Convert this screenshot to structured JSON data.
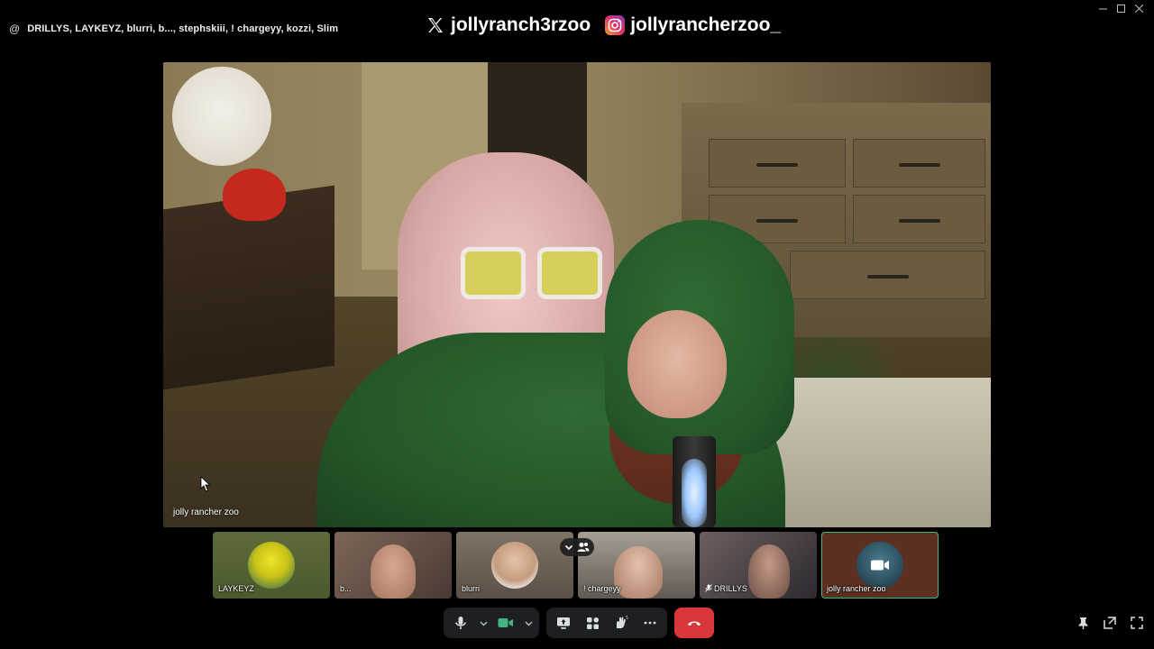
{
  "header": {
    "at_symbol": "@",
    "participants_summary": "DRILLYS, LAYKEYZ, blurri, b..., stephskiii, ! chargeyy, kozzi, Slim"
  },
  "overlay": {
    "x_handle": "jollyranch3rzoo",
    "instagram_handle": "jollyrancherzoo_"
  },
  "main_video": {
    "speaker_name": "jolly rancher zoo"
  },
  "participants": [
    {
      "name": "LAYKEYZ"
    },
    {
      "name": "b..."
    },
    {
      "name": "blurri"
    },
    {
      "name": "! chargeyy"
    },
    {
      "name": "DRILLYS"
    },
    {
      "name": "jolly rancher zoo"
    }
  ],
  "controls": {
    "microphone": "mic-icon",
    "camera": "camera-icon",
    "screen_share": "screen-share-icon",
    "activities": "activities-icon",
    "soundboard": "soundboard-icon",
    "more": "more-icon",
    "disconnect": "hangup-icon"
  },
  "colors": {
    "hangup": "#da373c",
    "active_border": "#43b581",
    "control_bg": "#1e1f22",
    "camera_on": "#43b581"
  }
}
